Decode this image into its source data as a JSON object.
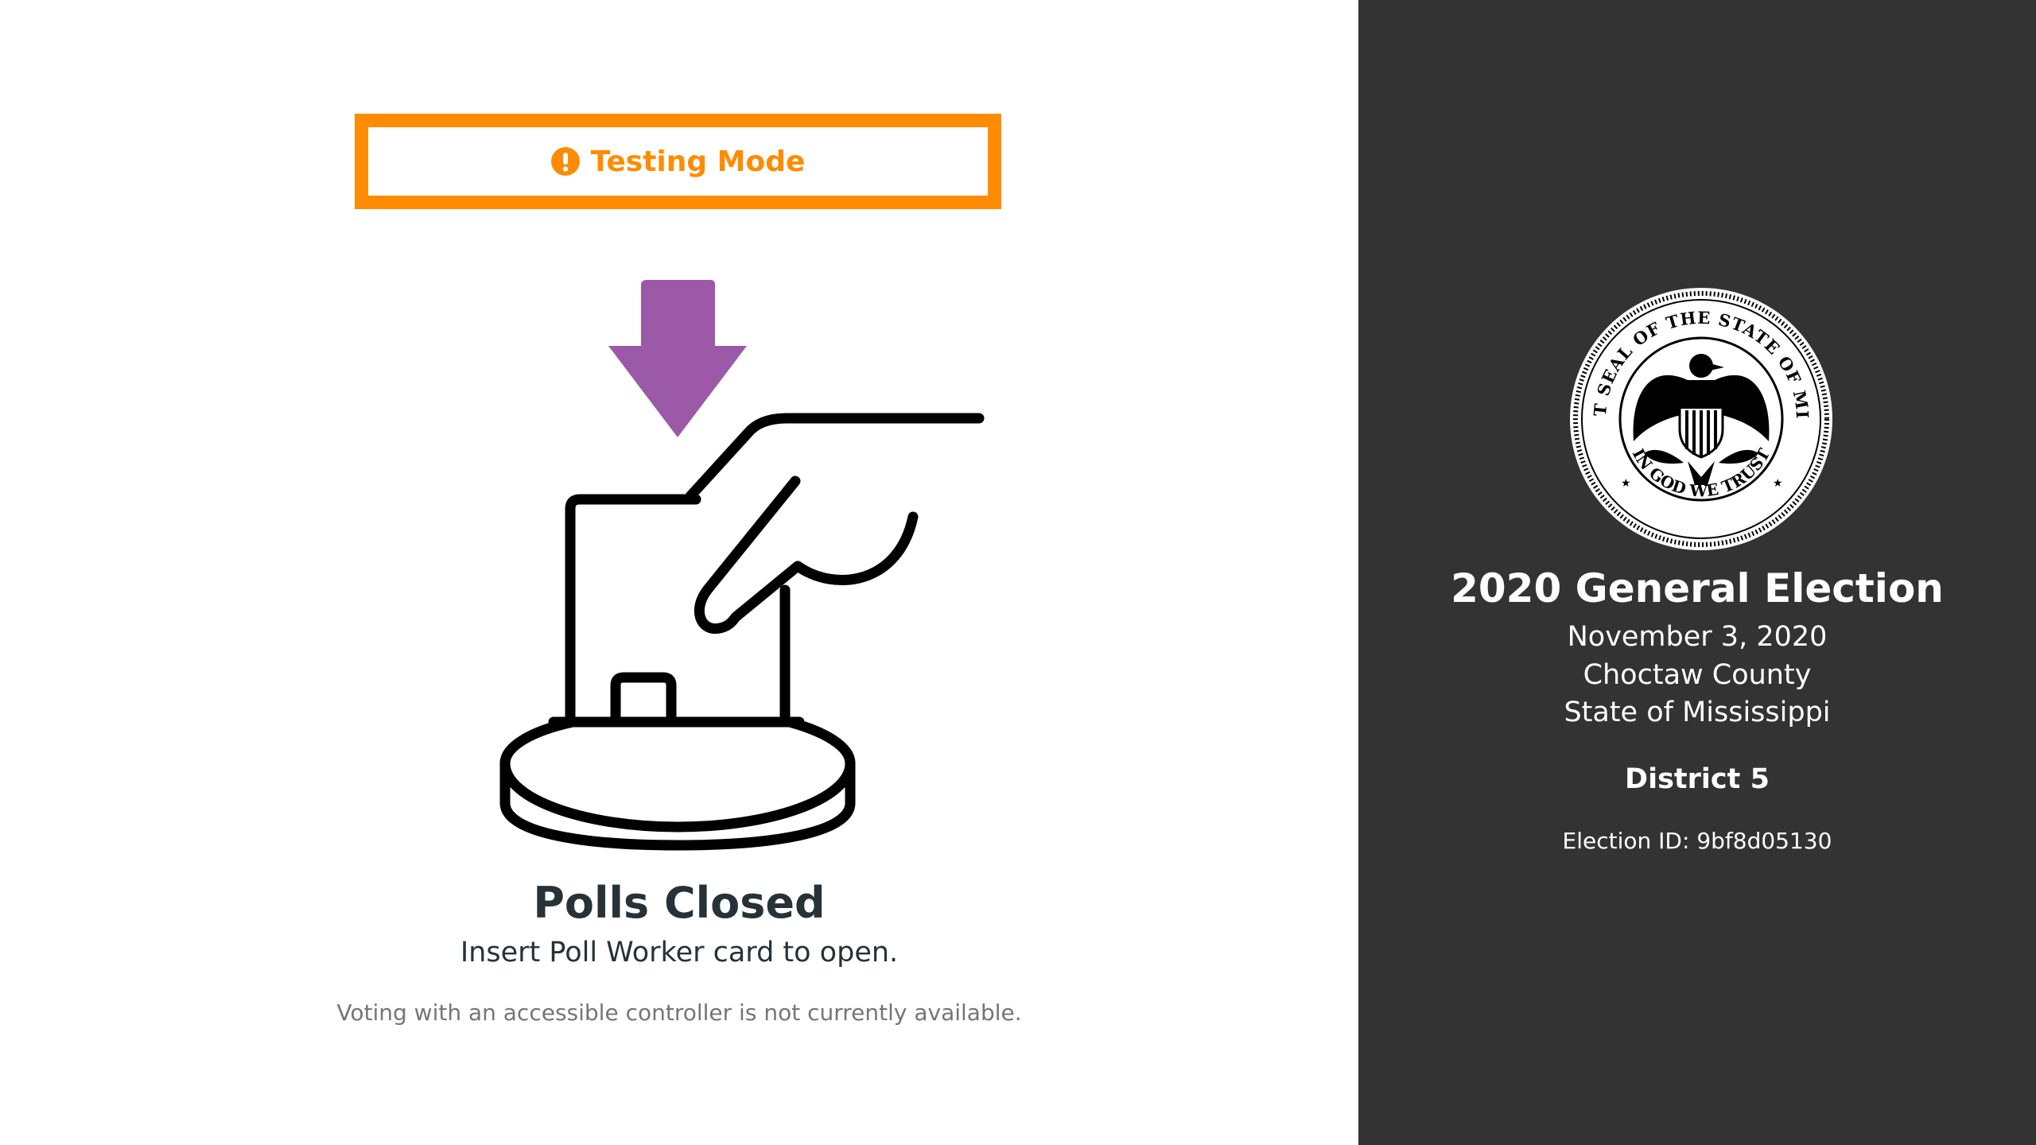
{
  "banner": {
    "label": "Testing Mode",
    "icon": "exclamation-circle-icon",
    "color": "#ff8c00"
  },
  "illustration": {
    "icon": "insert-card-icon",
    "arrow_color": "#9b59a8"
  },
  "status": {
    "title": "Polls Closed",
    "instruction": "Insert Poll Worker card to open.",
    "accessible_note": "Voting with an accessible controller is not currently available."
  },
  "election": {
    "seal_top_text": "THE GREAT SEAL OF THE STATE OF MISSISSIPPI",
    "seal_bottom_text": "IN GOD WE TRUST",
    "title": "2020 General Election",
    "date": "November 3, 2020",
    "county": "Choctaw County",
    "state": "State of Mississippi",
    "precinct": "District 5",
    "election_id_label": "Election ID: 9bf8d05130"
  },
  "colors": {
    "sidebar_bg": "#333333",
    "text_dark": "#263238",
    "text_muted": "#757575"
  }
}
